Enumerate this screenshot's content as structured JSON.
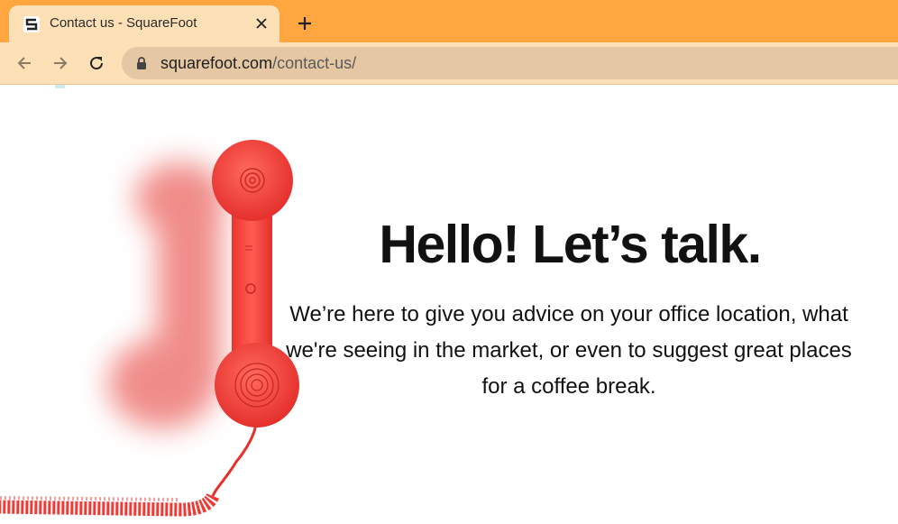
{
  "browser": {
    "tab": {
      "title": "Contact us - SquareFoot",
      "favicon": "squarefoot-logo-icon",
      "close": "close-icon"
    },
    "new_tab": "plus-icon",
    "toolbar": {
      "back": "arrow-left-icon",
      "forward": "arrow-right-icon",
      "reload": "reload-icon",
      "lock": "lock-icon",
      "url_host": "squarefoot.com",
      "url_path": "/contact-us/"
    },
    "colors": {
      "tabstrip": "#ffa640",
      "toolbar": "#fde0b6",
      "omnibox": "#e5c7a4"
    }
  },
  "page": {
    "headline": "Hello! Let’s talk.",
    "intro": "We’re here to give you advice on your office location, what we're seeing in the market, or even to suggest great places for a coffee break.",
    "hero_image": "red-telephone-handset-image",
    "accent_color": "#f23d3a"
  }
}
